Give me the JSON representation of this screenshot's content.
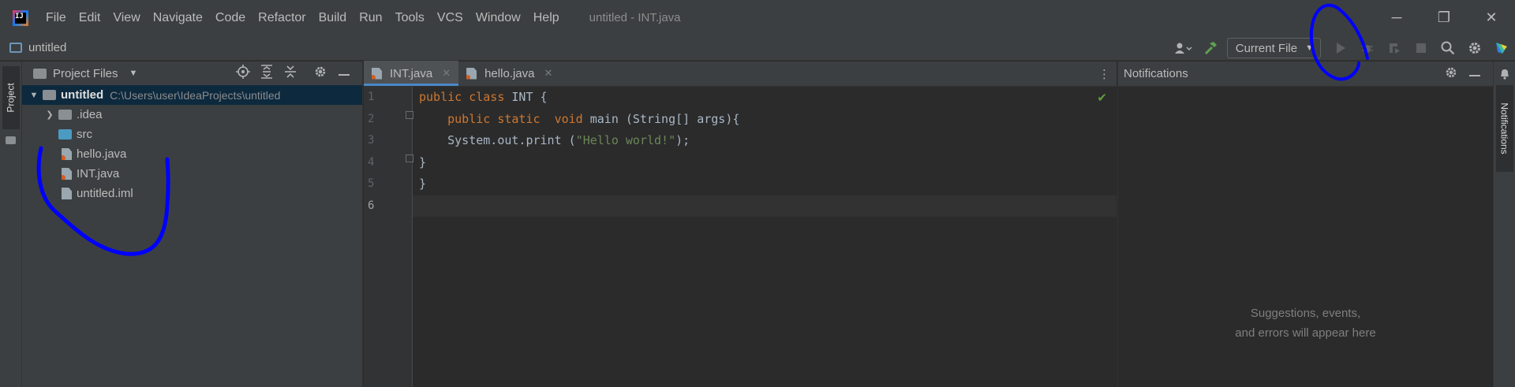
{
  "menubar": {
    "logo_text": "IJ",
    "items": [
      "File",
      "Edit",
      "View",
      "Navigate",
      "Code",
      "Refactor",
      "Build",
      "Run",
      "Tools",
      "VCS",
      "Window",
      "Help"
    ],
    "window_title": "untitled - INT.java"
  },
  "window_controls": {
    "minimize": "─",
    "maximize": "❐",
    "close": "✕"
  },
  "navbar": {
    "project_name": "untitled"
  },
  "toolbar": {
    "run_config": "Current File"
  },
  "left_stripe": {
    "project_tab": "Project"
  },
  "right_stripe": {
    "notifications_tab": "Notifications"
  },
  "project_panel": {
    "title": "Project Files",
    "tree": {
      "root": {
        "name": "untitled",
        "path": "C:\\Users\\user\\IdeaProjects\\untitled"
      },
      "items": [
        {
          "name": ".idea",
          "type": "folder"
        },
        {
          "name": "src",
          "type": "source-folder"
        },
        {
          "name": "hello.java",
          "type": "java-file"
        },
        {
          "name": "INT.java",
          "type": "java-file"
        },
        {
          "name": "untitled.iml",
          "type": "iml-file"
        }
      ]
    }
  },
  "editor": {
    "tabs": [
      {
        "label": "INT.java",
        "active": true
      },
      {
        "label": "hello.java",
        "active": false
      }
    ],
    "line_numbers": [
      "1",
      "2",
      "3",
      "4",
      "5",
      "6"
    ],
    "code": {
      "l1_kw": "public class",
      "l1_rest": " INT {",
      "l2_indent": "    ",
      "l2_kw": "public static  void",
      "l2_rest": " main (String[] args){",
      "l3_pre": "    System.out.print (",
      "l3_str": "\"Hello world!\"",
      "l3_post": ");",
      "l4": "}",
      "l5": "}",
      "l6": ""
    }
  },
  "notifications": {
    "title": "Notifications",
    "empty_line1": "Suggestions, events,",
    "empty_line2": "and errors will appear here"
  },
  "colors": {
    "annotation": "#0000ff",
    "keyword": "#cc7832",
    "string": "#6a8759"
  }
}
